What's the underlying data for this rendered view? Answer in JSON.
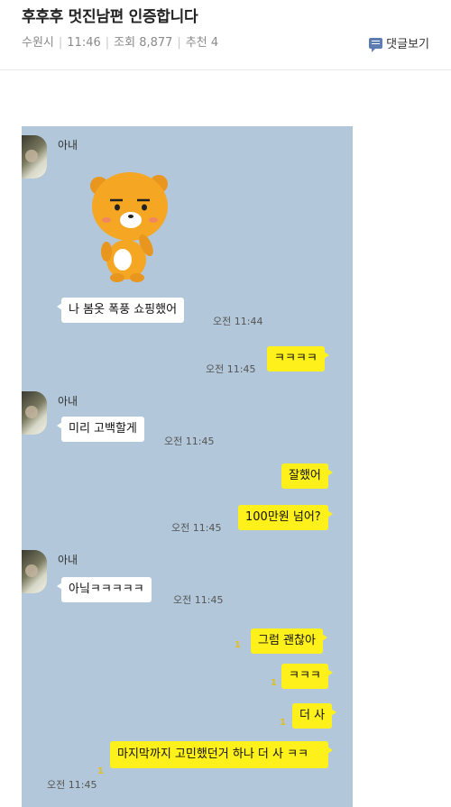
{
  "post": {
    "title": "후후후 멋진남편 인증합니다",
    "location": "수원시",
    "time": "11:46",
    "views": "조회 8,877",
    "recommend": "추천 4",
    "comments_label": "댓글보기"
  },
  "chat": {
    "sender_name": "아내",
    "messages": [
      {
        "text": "나 봄옷 폭풍 쇼핑했어",
        "time": "오전 11:44"
      },
      {
        "text": "ㅋㅋㅋㅋ",
        "time": "오전 11:45"
      },
      {
        "text": "미리 고백할게",
        "time": "오전 11:45"
      },
      {
        "text": "잘했어",
        "time": ""
      },
      {
        "text": "100만원 넘어?",
        "time": "오전 11:45"
      },
      {
        "text": "아닠ㅋㅋㅋㅋㅋ",
        "time": "오전 11:45"
      },
      {
        "text": "그럼 괜찮아",
        "time": ""
      },
      {
        "text": "ㅋㅋㅋ",
        "time": ""
      },
      {
        "text": "더 사",
        "time": ""
      },
      {
        "text": "마지막까지 고민했던거 하나 더 사 ㅋㅋ",
        "time": "오전 11:45"
      }
    ],
    "unread_mark": "1"
  }
}
